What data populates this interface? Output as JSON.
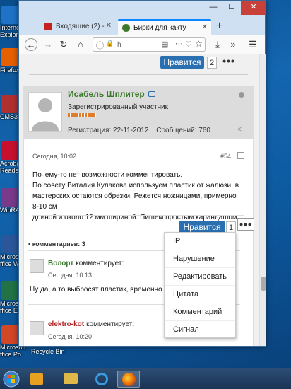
{
  "desktop": {
    "icons": [
      {
        "label": "Internet",
        "label2": "Explore",
        "icon": "ie-icon",
        "color": "#1e73c8"
      },
      {
        "label": "Firefox",
        "label2": "",
        "icon": "firefox-icon",
        "color": "#e66000"
      },
      {
        "label": "CMS3",
        "label2": "",
        "icon": "cms-icon",
        "color": "#b03030"
      },
      {
        "label": "Acrobat",
        "label2": "Reader D",
        "icon": "acrobat-icon",
        "color": "#c8102e"
      },
      {
        "label": "WinRAR",
        "label2": "",
        "icon": "winrar-icon",
        "color": "#7a3a8a"
      },
      {
        "label": "Microso",
        "label2": "ffice Wo",
        "icon": "word-icon",
        "color": "#2b579a"
      },
      {
        "label": "Microso",
        "label2": "ffice Ex",
        "icon": "excel-icon",
        "color": "#217346"
      },
      {
        "label": "Microsoft",
        "label2": "ffice Po",
        "icon": "powerpoint-icon",
        "color": "#d24726"
      }
    ],
    "recycle_bin": "Recycle Bin"
  },
  "browser": {
    "tabs": [
      {
        "label": "Входящие (2) - ",
        "icon": "gmail-icon",
        "color": "#c5221f"
      },
      {
        "label": "Бирки для какту",
        "icon": "site-favicon",
        "color": "#3a7a2a"
      }
    ],
    "new_tab": "+",
    "window_controls": {
      "minimize": "—",
      "maximize": "☐",
      "close": "✕"
    },
    "url_text": "h",
    "nav": {
      "back": "←",
      "forward": "→",
      "reload": "↻",
      "home": "⌂",
      "info": "ⓘ",
      "lock": "🔒",
      "reader": "▤",
      "more_page": "⋯",
      "pocket": "♡",
      "bookmark": "☆",
      "download": "⤓",
      "overflow": "»",
      "menu": "☰"
    }
  },
  "page": {
    "top_like": {
      "label": "Нравится",
      "count": "2",
      "more": "•••"
    },
    "post": {
      "author": "Исабель Шплитер",
      "role": "Зарегистрированный участник",
      "registration": "Регистрация: 22-11-2012",
      "messages": "Сообщений: 760",
      "date": "Сегодня, 10:02",
      "number": "#54",
      "text_lines": [
        "Почему-то нет возможности комментировать.",
        "По совету Виталия Кулакова используем пластик от жалюзи, в",
        "мастерских остаются обрезки. Режется ножницами, примерно 8-10 см",
        "длиной и около 12 мм шириной. Пишем простым карандашом."
      ],
      "like": {
        "label": "Нравится",
        "count": "1",
        "more": "•••"
      }
    },
    "comments": {
      "header": "комментариев: 3",
      "items": [
        {
          "author": "Волорт",
          "verb": "комментирует:",
          "time": "Сегодня, 10:13",
          "text": "Ну да, а то выбросят пластик, временно пом"
        },
        {
          "author": "elektro-kot",
          "verb": "комментирует:",
          "time": "Сегодня, 10:20",
          "text": ""
        }
      ]
    },
    "dropdown": [
      "IP",
      "Нарушение",
      "Редактировать",
      "Цитата",
      "Комментарий",
      "Сигнал"
    ]
  },
  "colors": {
    "accent": "#2a6fb0",
    "username": "#3a7a2a"
  }
}
